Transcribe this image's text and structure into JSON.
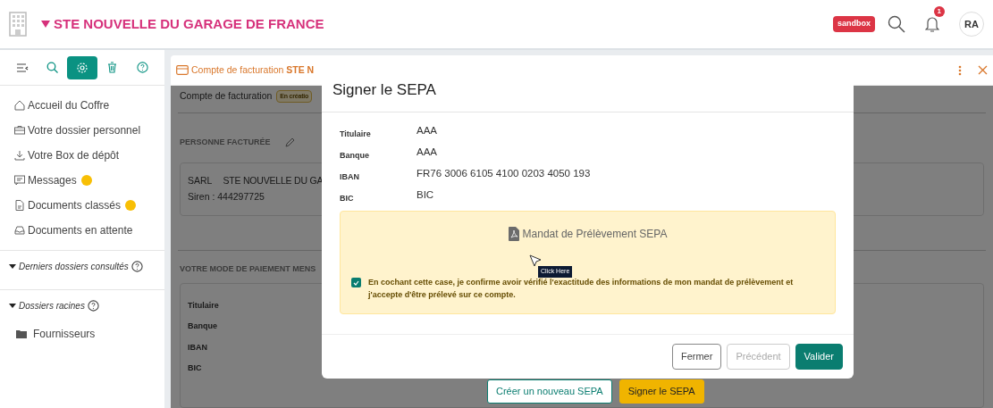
{
  "topbar": {
    "title": "STE NOUVELLE DU GARAGE DE FRANCE",
    "env_badge": "sandbox",
    "notification_count": "1",
    "avatar": "RA"
  },
  "sidebar": {
    "tools": [
      {
        "kind": "collapse",
        "selected": false
      },
      {
        "kind": "search",
        "selected": false
      },
      {
        "kind": "settings",
        "selected": true
      },
      {
        "kind": "trash",
        "selected": false
      },
      {
        "kind": "help",
        "selected": false
      }
    ],
    "items": [
      {
        "label": "Accueil du Coffre",
        "unread": false
      },
      {
        "label": "Votre dossier personnel",
        "unread": false
      },
      {
        "label": "Votre Box de dépôt",
        "unread": false
      },
      {
        "label": "Messages",
        "unread": true
      },
      {
        "label": "Documents classés",
        "unread": true
      },
      {
        "label": "Documents en attente",
        "unread": false
      }
    ],
    "sections": [
      {
        "label": "Derniers dossiers consultés",
        "expanded": true
      },
      {
        "label": "Dossiers racines",
        "expanded": true,
        "children": [
          {
            "label": "Fournisseurs"
          }
        ]
      }
    ]
  },
  "panel": {
    "breadcrumb": {
      "label": "Compte de facturation",
      "entity": "STE N"
    },
    "page_title": "Compte de facturation",
    "status_badge": "En créatio",
    "billed_section": {
      "heading": "PERSONNE FACTURÉE",
      "legal_form": "SARL",
      "company": "STE NOUVELLE DU GA",
      "siren": "Siren : 444297725"
    },
    "payment_section": {
      "heading": "VOTRE MODE DE PAIEMENT MENS",
      "labels": [
        "Titulaire",
        "Banque",
        "IBAN",
        "BIC"
      ]
    },
    "actions": [
      {
        "label": "Créer un nouveau SEPA",
        "kind": "outline"
      },
      {
        "label": "Signer le SEPA",
        "kind": "warning"
      }
    ]
  },
  "modal": {
    "title": "Signer le SEPA",
    "fields": [
      {
        "label": "Titulaire",
        "value": "AAA"
      },
      {
        "label": "Banque",
        "value": "AAA"
      },
      {
        "label": "IBAN",
        "value": "FR76 3006 6105 4100 0203 4050 193"
      },
      {
        "label": "BIC",
        "value": "BIC"
      }
    ],
    "mandate": {
      "document": "Mandat de Prélèvement SEPA",
      "consent": {
        "checked": true,
        "text": "En cochant cette case, je confirme avoir vérifié l'exactitude des informations de mon mandat de prélèvement et j'accepte d'être prélevé sur ce compte."
      }
    },
    "cursor_tooltip": "Click Here",
    "buttons": [
      {
        "label": "Fermer",
        "kind": "secondary",
        "disabled": false
      },
      {
        "label": "Précédent",
        "kind": "secondary",
        "disabled": true
      },
      {
        "label": "Valider",
        "kind": "primary",
        "disabled": false
      }
    ]
  }
}
